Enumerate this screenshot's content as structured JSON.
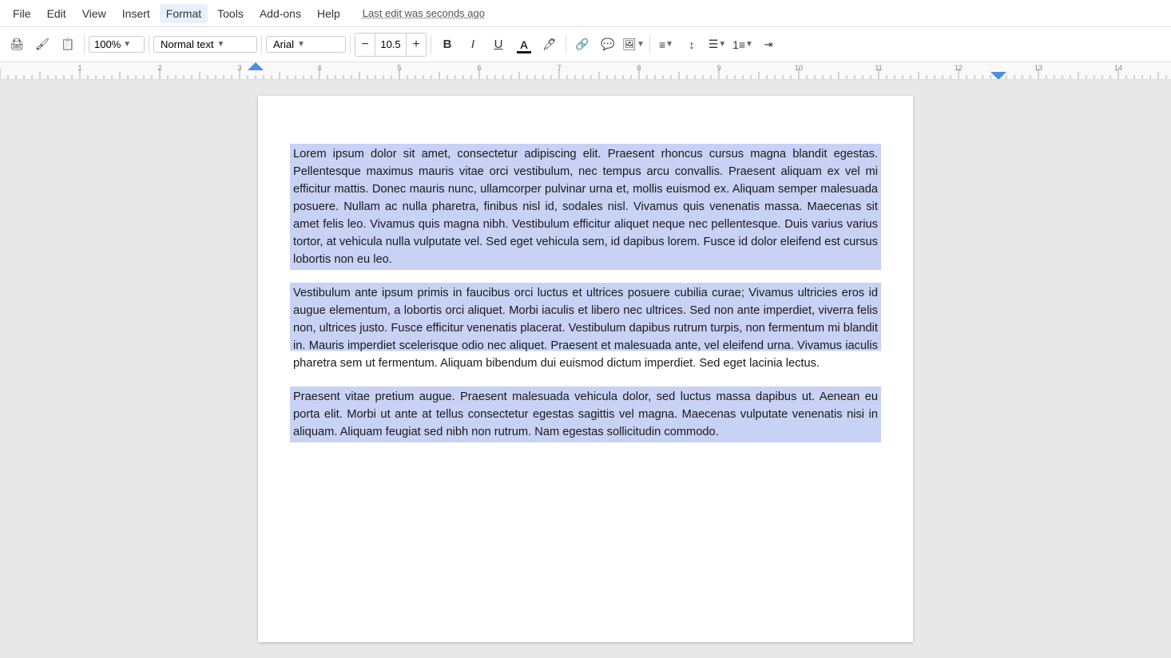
{
  "menubar": {
    "items": [
      "File",
      "Edit",
      "View",
      "Insert",
      "Format",
      "Tools",
      "Add-ons",
      "Help"
    ],
    "last_edit": "Last edit was seconds ago"
  },
  "toolbar": {
    "zoom": "100%",
    "style": "Normal text",
    "font": "Arial",
    "font_size": "10.5",
    "bold_label": "B",
    "italic_label": "I",
    "underline_label": "U"
  },
  "document": {
    "paragraphs": [
      "Lorem ipsum dolor sit amet, consectetur adipiscing elit. Praesent rhoncus cursus magna blandit egestas. Pellentesque maximus mauris vitae orci vestibulum, nec tempus arcu convallis. Praesent aliquam ex vel mi efficitur mattis. Donec mauris nunc, ullamcorper pulvinar urna et, mollis euismod ex. Aliquam semper malesuada posuere. Nullam ac nulla pharetra, finibus nisl id, sodales nisl. Vivamus quis venenatis massa. Maecenas sit amet felis leo. Vivamus quis magna nibh. Vestibulum efficitur aliquet neque nec pellentesque. Duis varius varius tortor, at vehicula nulla vulputate vel. Sed eget vehicula sem, id dapibus lorem. Fusce id dolor eleifend est cursus lobortis non eu leo.",
      "Vestibulum ante ipsum primis in faucibus orci luctus et ultrices posuere cubilia curae; Vivamus ultricies eros id augue elementum, a lobortis orci aliquet. Morbi iaculis et libero nec ultrices. Sed non ante imperdiet, viverra felis non, ultrices justo. Fusce efficitur venenatis placerat. Vestibulum dapibus rutrum turpis, non fermentum mi blandit in. Mauris imperdiet scelerisque odio nec aliquet. Praesent et malesuada ante, vel eleifend urna. Vivamus iaculis pharetra sem ut fermentum. Aliquam bibendum dui euismod dictum imperdiet. Sed eget lacinia lectus.",
      "Praesent vitae pretium augue. Praesent malesuada vehicula dolor, sed luctus massa dapibus ut. Aenean eu porta elit. Morbi ut ante at tellus consectetur egestas sagittis vel magna. Maecenas vulputate venenatis nisi in aliquam. Aliquam feugiat sed nibh non rutrum. Nam egestas sollicitudin commodo."
    ]
  },
  "side_buttons": {
    "add_label": "+",
    "comment_label": "💬"
  }
}
